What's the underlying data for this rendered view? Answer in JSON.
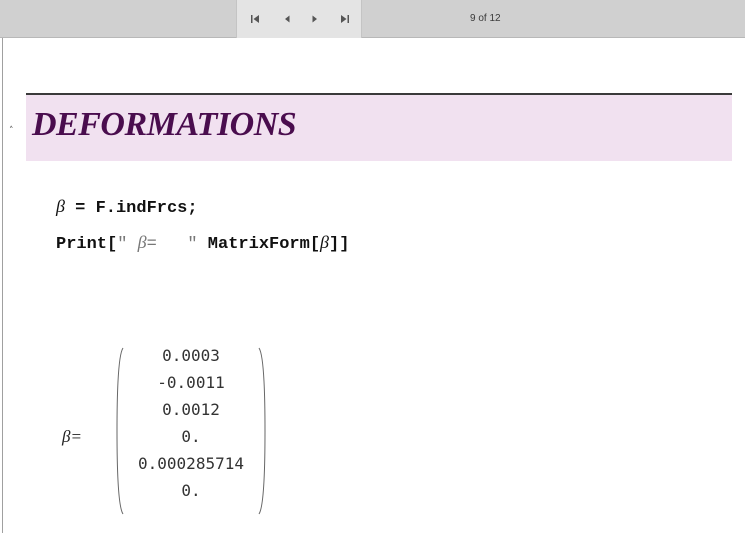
{
  "toolbar": {
    "page_indicator": "9 of 12",
    "nav_icons": [
      "first-page-icon",
      "previous-page-icon",
      "next-page-icon",
      "last-page-icon"
    ]
  },
  "section": {
    "title": "DEFORMATIONS",
    "collapse_glyph": "˄"
  },
  "input_cell": {
    "line1_beta": "β",
    "line1_rest": " = F.indFrcs;",
    "line2_print": "Print[",
    "line2_string_open": "\" ",
    "line2_string_beta": "β",
    "line2_string_rest": "=   \"",
    "line2_matrix": " MatrixForm[",
    "line2_beta": "β",
    "line2_close": "]]"
  },
  "output": {
    "label": "β=",
    "matrix_values": [
      "0.0003",
      "-0.0011",
      "0.0012",
      "0.",
      "0.000285714",
      "0."
    ]
  },
  "colors": {
    "title": "#4a0d4e",
    "header_bg": "#f1e1f0",
    "toolbar_bg": "#d0d0d0"
  }
}
